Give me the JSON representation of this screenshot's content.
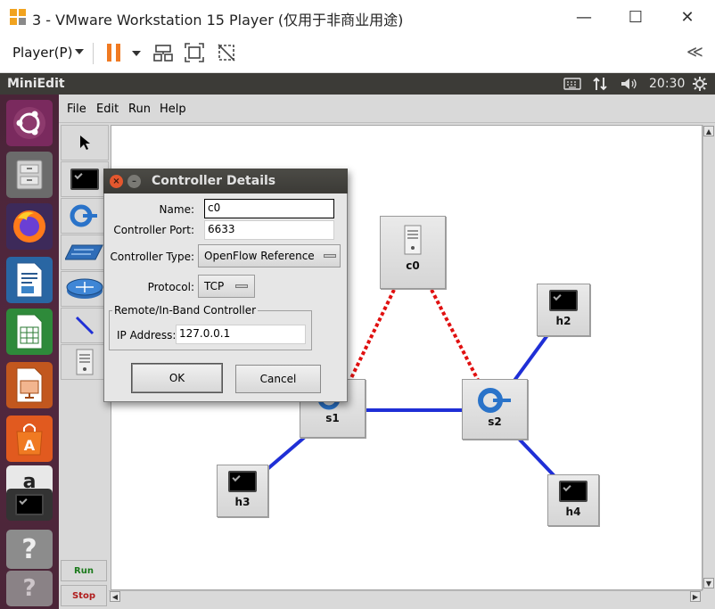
{
  "vm": {
    "title": "3 - VMware Workstation 15 Player (仅用于非商业用途)",
    "player_menu": "Player(P)"
  },
  "panel": {
    "app_name": "MiniEdit",
    "clock": "20:30"
  },
  "miniedit": {
    "menu": [
      "File",
      "Edit",
      "Run",
      "Help"
    ],
    "run_label": "Run",
    "stop_label": "Stop"
  },
  "nodes": {
    "c0": "c0",
    "s1": "s1",
    "s2": "s2",
    "h2": "h2",
    "h3": "h3",
    "h4": "h4"
  },
  "dialog": {
    "title": "Controller Details",
    "name_label": "Name:",
    "name_value": "c0",
    "port_label": "Controller Port:",
    "port_value": "6633",
    "type_label": "Controller Type:",
    "type_value": "OpenFlow Reference",
    "protocol_label": "Protocol:",
    "protocol_value": "TCP",
    "group_title": "Remote/In-Band Controller",
    "ip_label": "IP Address:",
    "ip_value": "127.0.0.1",
    "ok_label": "OK",
    "cancel_label": "Cancel"
  },
  "colors": {
    "link": "#1f2fd6",
    "controller_link": "#e01010",
    "accent_orange": "#f07a22"
  }
}
